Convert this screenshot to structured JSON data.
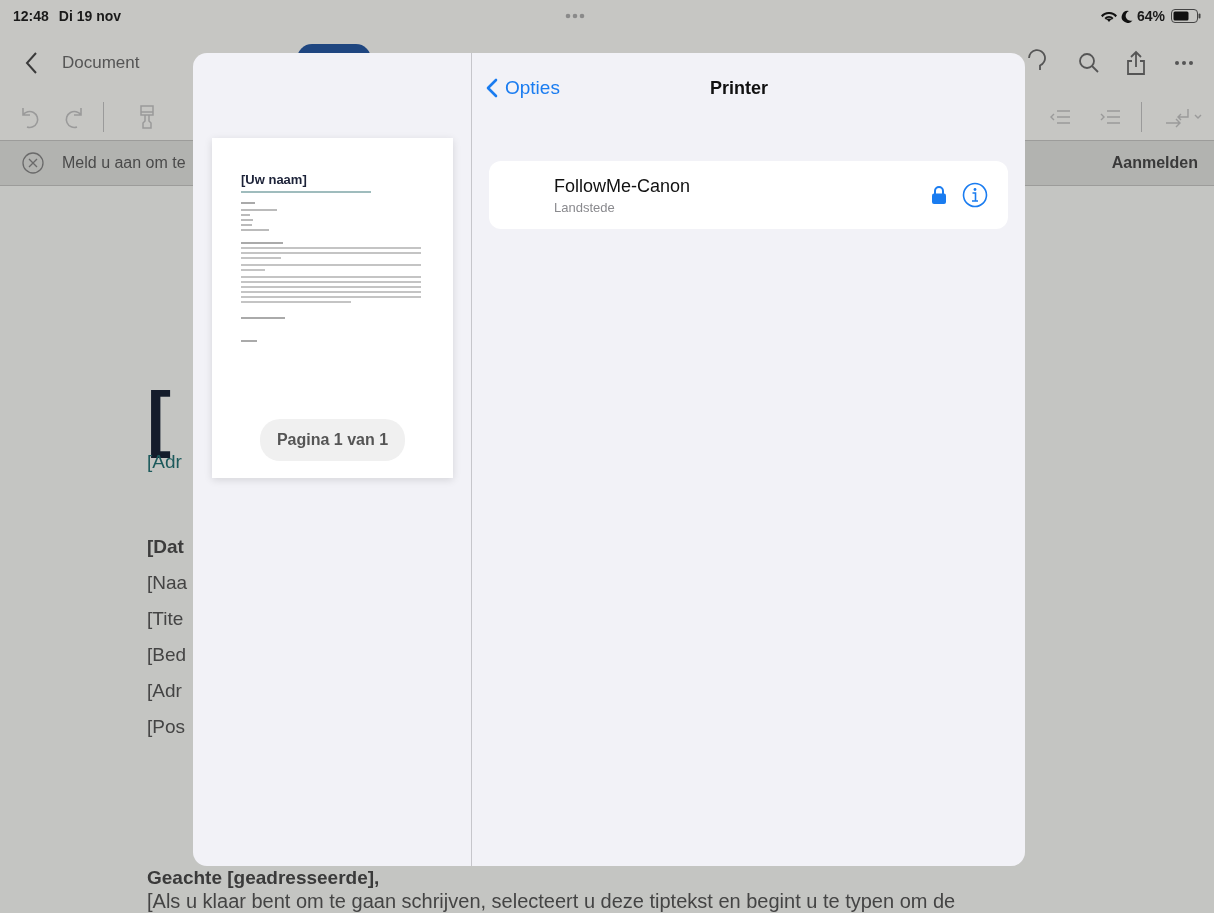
{
  "status_bar": {
    "time": "12:48",
    "date": "Di 19 nov",
    "battery": "64%"
  },
  "toolbar": {
    "back_label": "Document"
  },
  "notification": {
    "message": "Meld u aan om te",
    "action": "Aanmelden"
  },
  "document": [
    {
      "kind": "title",
      "text": "["
    },
    {
      "kind": "contact",
      "text": "[Adr"
    },
    {
      "kind": "heading",
      "text": "[Dat"
    },
    {
      "kind": "line",
      "text": "[Naa"
    },
    {
      "kind": "line",
      "text": "[Tite"
    },
    {
      "kind": "line",
      "text": "[Bed"
    },
    {
      "kind": "line",
      "text": "[Adr"
    },
    {
      "kind": "line",
      "text": "[Pos"
    },
    {
      "kind": "greeting",
      "text": "Geachte [geadresseerde],"
    },
    {
      "kind": "body",
      "text": "[Als u klaar bent om te gaan schrijven, selecteert u deze tiptekst en begint u te typen om de"
    }
  ],
  "print_dialog": {
    "back": "Opties",
    "title": "Printer",
    "preview": {
      "title": "[Uw naam]",
      "page_indicator": "Pagina 1 van 1"
    },
    "printers": [
      {
        "name": "FollowMe-Canon",
        "location": "Landstede",
        "locked": true
      }
    ]
  }
}
